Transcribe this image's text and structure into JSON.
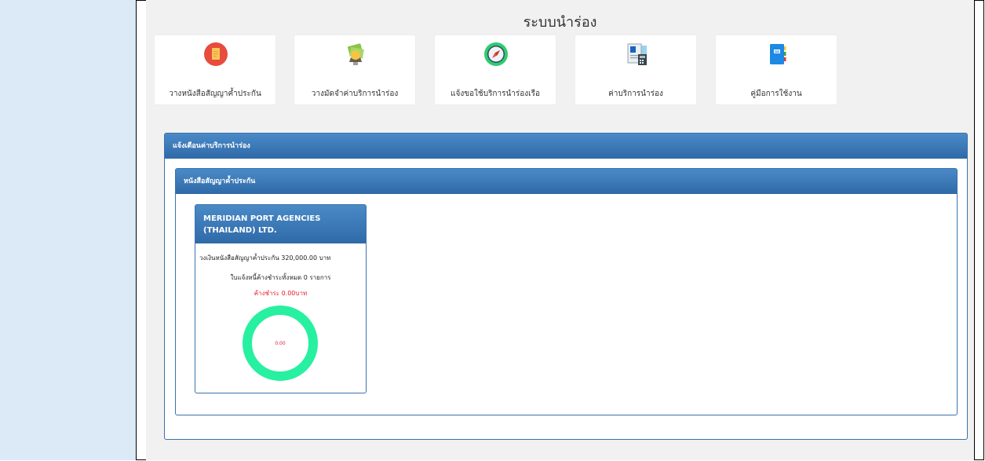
{
  "page": {
    "title": "ระบบนำร่อง"
  },
  "menu": [
    {
      "label": "วางหนังสือสัญญาค้ำประกัน",
      "icon": "document-guarantee-icon"
    },
    {
      "label": "วางมัดจำค่าบริการนำร่อง",
      "icon": "money-deposit-icon"
    },
    {
      "label": "แจ้งขอใช้บริการนำร่องเรือ",
      "icon": "compass-icon"
    },
    {
      "label": "ค่าบริการนำร่อง",
      "icon": "invoice-calculator-icon"
    },
    {
      "label": "คู่มือการใช้งาน",
      "icon": "manual-book-icon"
    }
  ],
  "panel": {
    "title": "แจ้งเตือนค่าบริการนำร่อง",
    "sub_title": "หนังสือสัญญาค้ำประกัน",
    "company": {
      "name": "MERIDIAN PORT AGENCIES (THAILAND) LTD.",
      "guarantee_text": "วงเงินหนังสือสัญญาค้ำประกัน 320,000.00 บาท",
      "invoice_text": "ใบแจ้งหนี้ค้างชำระทั้งหมด 0 รายการ",
      "outstanding_text": "ค้างชำระ 0.00บาท",
      "donut_value": "0.00",
      "donut_fraction": 0
    }
  },
  "colors": {
    "sidebar": "#dce9f7",
    "header_blue": "#3a73ac",
    "donut": "#27f0a0",
    "alert_red": "#e8192c"
  }
}
